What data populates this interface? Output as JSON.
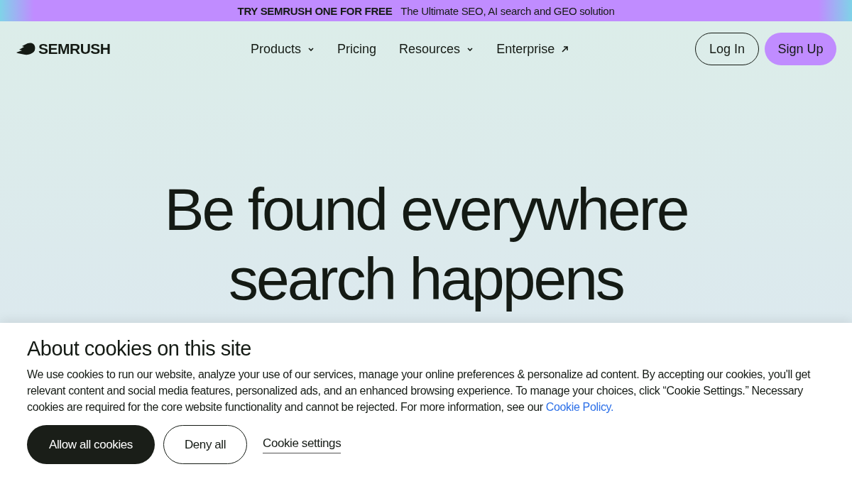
{
  "promo_banner": {
    "label": "TRY SEMRUSH ONE FOR FREE",
    "text": "The Ultimate SEO, AI search and GEO solution"
  },
  "header": {
    "logo": "SEMRUSH",
    "nav": [
      {
        "label": "Products",
        "kind": "dropdown"
      },
      {
        "label": "Pricing",
        "kind": "plain"
      },
      {
        "label": "Resources",
        "kind": "dropdown"
      },
      {
        "label": "Enterprise",
        "kind": "external"
      }
    ],
    "buttons": [
      {
        "label": "Log In",
        "kind": "outline"
      },
      {
        "label": "Sign Up",
        "kind": "filled"
      }
    ]
  },
  "hero": {
    "headline_lines": [
      "Be found everywhere",
      "search happens"
    ]
  },
  "cookie_banner": {
    "title": "About cookies on this site",
    "text": "We use cookies to run our website, analyze your use of our services, manage your online preferences & personalize ad content. By accepting our cookies, you'll get relevant content and social media features, personalized ads, and an enhanced browsing experience. To manage your choices, click “Cookie Settings.” Necessary cookies are required for the core website functionality and cannot be rejected. For more information, see our",
    "link": "Cookie Policy.",
    "buttons": [
      {
        "label": "Allow all cookies",
        "kind": "filled"
      },
      {
        "label": "Deny all",
        "kind": "outline"
      },
      {
        "label": "Cookie settings",
        "kind": "link"
      }
    ]
  }
}
